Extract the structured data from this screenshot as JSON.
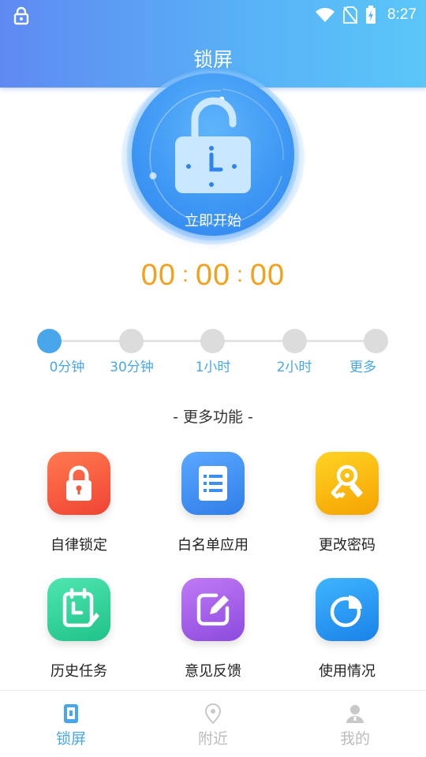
{
  "status_bar": {
    "time": "8:27"
  },
  "header": {
    "title": "锁屏"
  },
  "lock": {
    "start_label": "立即开始"
  },
  "timer": {
    "hours": "00",
    "minutes": "00",
    "seconds": "00",
    "separator": ":"
  },
  "durations": {
    "selected_index": 0,
    "options": [
      "0分钟",
      "30分钟",
      "1小时",
      "2小时",
      "更多"
    ]
  },
  "features": {
    "title": "- 更多功能 -",
    "items": [
      {
        "label": "自律锁定",
        "icon": "padlock-icon",
        "color": "#f45a3c"
      },
      {
        "label": "白名单应用",
        "icon": "list-icon",
        "color": "#3d8ff0"
      },
      {
        "label": "更改密码",
        "icon": "keys-icon",
        "color": "#f5b710"
      },
      {
        "label": "历史任务",
        "icon": "clipboard-clock-icon",
        "color": "#2fd09a"
      },
      {
        "label": "意见反馈",
        "icon": "edit-icon",
        "color": "#a05ce8"
      },
      {
        "label": "使用情况",
        "icon": "pie-chart-icon",
        "color": "#2d96ee"
      }
    ]
  },
  "bottom_nav": {
    "active_index": 0,
    "items": [
      {
        "label": "锁屏",
        "icon": "phone-lock-icon"
      },
      {
        "label": "附近",
        "icon": "location-pin-icon"
      },
      {
        "label": "我的",
        "icon": "user-icon"
      }
    ]
  },
  "colors": {
    "accent": "#4aa6ea",
    "timer": "#f3a01c",
    "header_start": "#5f8af2",
    "header_end": "#5bc6f8"
  }
}
